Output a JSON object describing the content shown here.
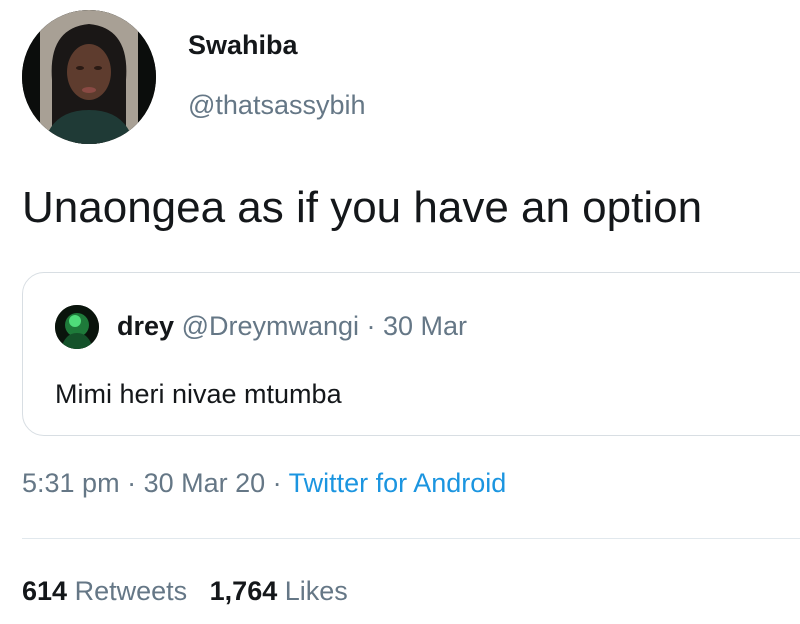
{
  "author": {
    "display_name": "Swahiba",
    "handle": "@thatsassybih",
    "avatar_icon": "profile-photo"
  },
  "tweet": {
    "text": "Unaongea as if you have an option"
  },
  "quoted_tweet": {
    "display_name": "drey",
    "handle": "@Dreymwangi",
    "separator": " · ",
    "date": "30 Mar",
    "text": "Mimi heri nivae mtumba",
    "avatar_icon": "profile-photo"
  },
  "meta": {
    "time": "5:31 pm",
    "separator": " · ",
    "date": "30 Mar 20",
    "source": "Twitter for Android"
  },
  "stats": {
    "retweets_count": "614",
    "retweets_label": "Retweets",
    "likes_count": "1,764",
    "likes_label": "Likes"
  },
  "colors": {
    "text_primary": "#14171a",
    "text_secondary": "#657786",
    "link": "#1b95e0",
    "border": "#d8dee3"
  }
}
